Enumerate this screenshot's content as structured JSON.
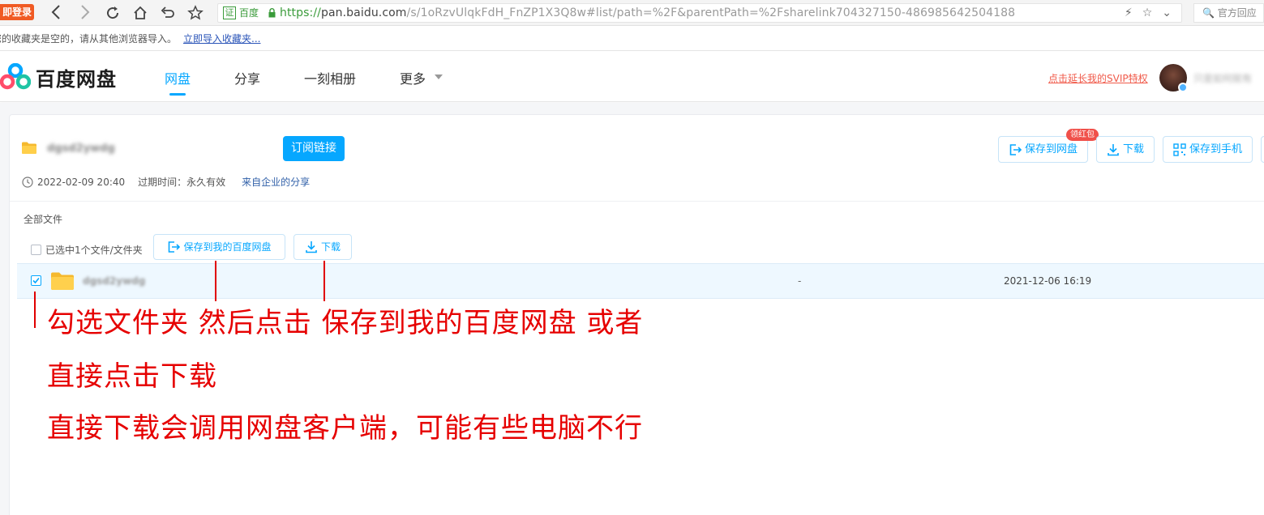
{
  "browser": {
    "login_badge": "即登录",
    "address": {
      "cert_site": "百度",
      "url_scheme": "https://",
      "url_host": "pan.baidu.com",
      "url_path": "/s/1oRzvUlqkFdH_FnZP1X3Q8w#list/path=%2F&parentPath=%2Fsharelink704327150-486985642504188"
    },
    "search_placeholder": "官方回应"
  },
  "bookmark_bar": {
    "empty_text": "您的收藏夹是空的，请从其他浏览器导入。",
    "import_link": "立即导入收藏夹..."
  },
  "header": {
    "logo_text": "百度网盘",
    "nav": [
      "网盘",
      "分享",
      "一刻相册",
      "更多"
    ],
    "svip_link": "点击延长我的SVIP特权",
    "user_name": "只是如何就有"
  },
  "share": {
    "title": "dgsd2ywdg",
    "subscribe_button": "订阅链接",
    "save_to_pan_button": "保存到网盘",
    "red_packet_badge": "领红包",
    "download_button": "下载",
    "save_to_phone_button": "保存到手机",
    "created_time": "2022-02-09 20:40",
    "expire_label": "过期时间：永久有效",
    "enterprise_link": "来自企业的分享"
  },
  "file_list": {
    "breadcrumb": "全部文件",
    "selection_label": "已选中1个文件/文件夹",
    "save_to_my_pan_button": "保存到我的百度网盘",
    "download_button": "下载",
    "rows": [
      {
        "name": "dgsd2ywdg",
        "size": "-",
        "date": "2021-12-06 16:19",
        "checked": true
      }
    ]
  },
  "annotations": {
    "line1": "勾选文件夹   然后点击  保存到我的百度网盘  或者",
    "line2": "直接点击下载",
    "line3": "直接下载会调用网盘客户端，可能有些电脑不行"
  },
  "colors": {
    "brand_blue": "#06a7ff",
    "annotation_red": "#e60000",
    "svip_red": "#f05a4a"
  }
}
